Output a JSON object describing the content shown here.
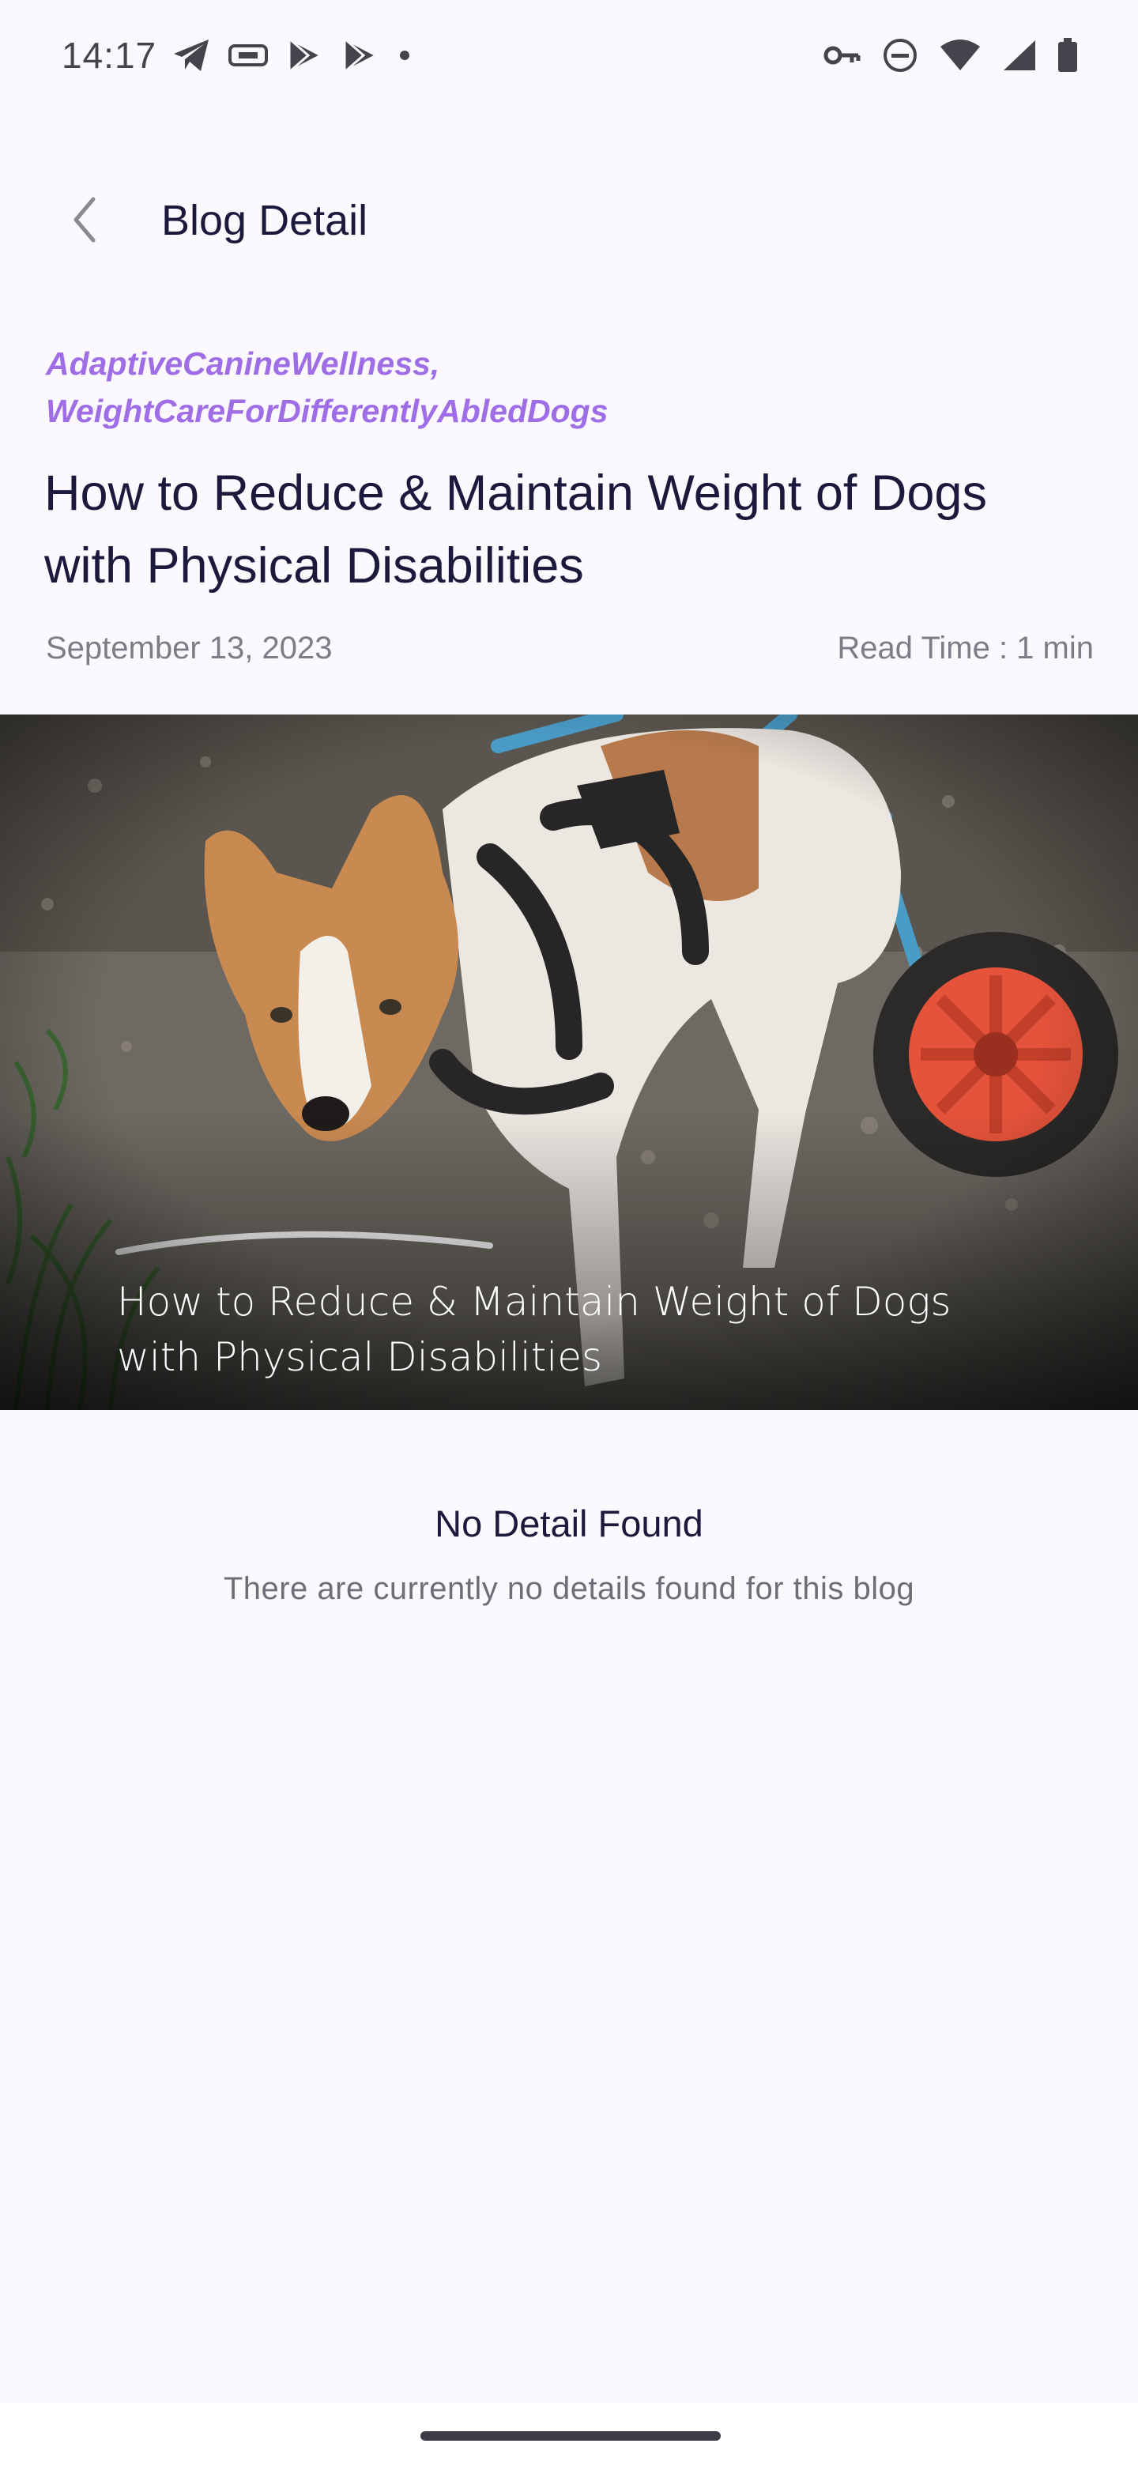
{
  "status_bar": {
    "time": "14:17",
    "left_icons": [
      "telegram-icon",
      "tag-icon",
      "play-store-icon",
      "play-store-icon",
      "dot-icon"
    ],
    "right_icons": [
      "vpn-key-icon",
      "do-not-disturb-icon",
      "wifi-icon",
      "signal-icon",
      "battery-icon"
    ]
  },
  "app_bar": {
    "title": "Blog Detail"
  },
  "blog": {
    "tags": [
      "AdaptiveCanineWellness,",
      "WeightCareForDifferentlyAbledDogs"
    ],
    "title": "How to Reduce & Maintain Weight of Dogs with Physical Disabilities",
    "date": "September 13, 2023",
    "read_time": "Read Time : 1 min",
    "hero_caption_line1": "How to Reduce & Maintain Weight of Dogs",
    "hero_caption_line2": "with Physical Disabilities"
  },
  "empty_state": {
    "title": "No Detail Found",
    "subtitle": "There are currently no details found for this blog"
  },
  "colors": {
    "background": "#fbf8fe",
    "tag": "#9f6ee6",
    "title": "#1b1a3d",
    "muted": "#7d7c87"
  }
}
